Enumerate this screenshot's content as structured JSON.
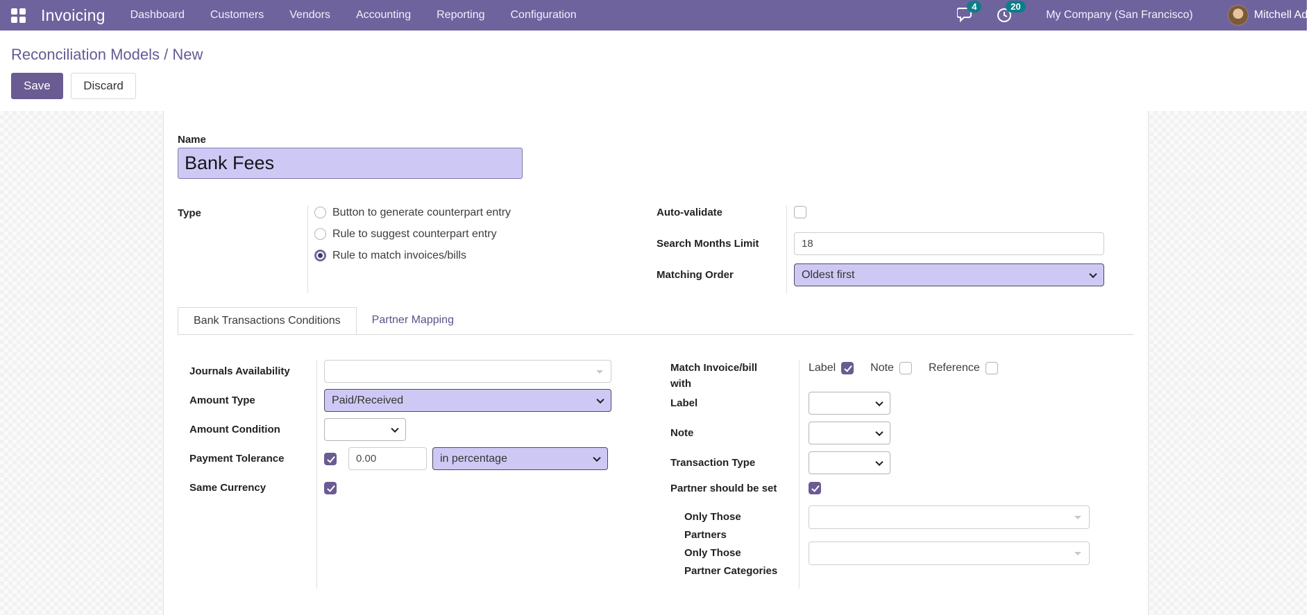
{
  "topbar": {
    "brand": "Invoicing",
    "menus": [
      "Dashboard",
      "Customers",
      "Vendors",
      "Accounting",
      "Reporting",
      "Configuration"
    ],
    "messages_count": "4",
    "activities_count": "20",
    "company": "My Company (San Francisco)",
    "user": "Mitchell Admin"
  },
  "breadcrumb": "Reconciliation Models / New",
  "actions": {
    "save": "Save",
    "discard": "Discard"
  },
  "form": {
    "name": {
      "label": "Name",
      "value": "Bank Fees"
    },
    "type": {
      "label": "Type",
      "options": [
        "Button to generate counterpart entry",
        "Rule to suggest counterpart entry",
        "Rule to match invoices/bills"
      ],
      "selected": "Rule to match invoices/bills"
    },
    "auto_validate": {
      "label": "Auto-validate",
      "checked": false
    },
    "search_months_limit": {
      "label": "Search Months Limit",
      "value": "18"
    },
    "matching_order": {
      "label": "Matching Order",
      "value": "Oldest first"
    },
    "tabs": {
      "active": "Bank Transactions Conditions",
      "items": [
        "Bank Transactions Conditions",
        "Partner Mapping"
      ]
    },
    "conditions": {
      "journals_availability": {
        "label": "Journals Availability",
        "value": ""
      },
      "amount_type": {
        "label": "Amount Type",
        "value": "Paid/Received"
      },
      "amount_condition": {
        "label": "Amount Condition",
        "value": ""
      },
      "payment_tolerance": {
        "label": "Payment Tolerance",
        "checked": true,
        "amount": "0.00",
        "mode": "in percentage"
      },
      "same_currency": {
        "label": "Same Currency",
        "checked": true
      },
      "match_invoice_bill_with": {
        "label": "Match Invoice/bill with",
        "options": [
          {
            "label": "Label",
            "checked": true
          },
          {
            "label": "Note",
            "checked": false
          },
          {
            "label": "Reference",
            "checked": false
          }
        ]
      },
      "label": {
        "label": "Label",
        "value": ""
      },
      "note": {
        "label": "Note",
        "value": ""
      },
      "transaction_type": {
        "label": "Transaction Type",
        "value": ""
      },
      "partner_should_be_set": {
        "label": "Partner should be set",
        "checked": true
      },
      "only_those_partners": {
        "label": "Only Those Partners",
        "value": ""
      },
      "only_those_partner_categories": {
        "label": "Only Those Partner Categories",
        "value": ""
      }
    }
  }
}
